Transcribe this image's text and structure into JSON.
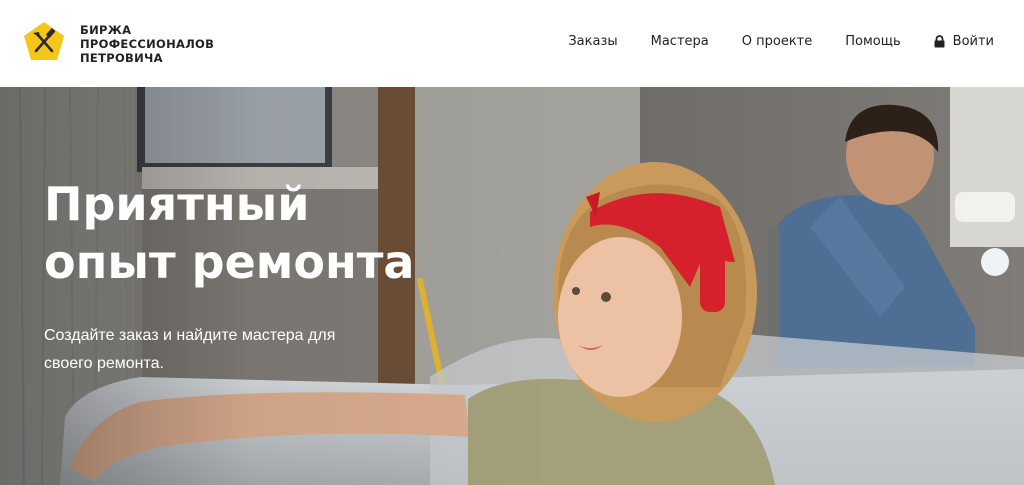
{
  "header": {
    "logo_icon": "hammer-shovel-pentagon-icon",
    "logo_lines": [
      "БИРЖА",
      "ПРОФЕССИОНАЛОВ",
      "ПЕТРОВИЧА"
    ],
    "nav": [
      {
        "label": "Заказы"
      },
      {
        "label": "Мастера"
      },
      {
        "label": "О проекте"
      },
      {
        "label": "Помощь"
      },
      {
        "label": "Войти",
        "icon": "lock-icon"
      }
    ]
  },
  "hero": {
    "title_line1": "Приятный",
    "title_line2": "опыт ремонта",
    "subtitle": "Создайте заказ и найдите мастера для своего ремонта."
  },
  "colors": {
    "accent": "#f5c518",
    "text": "#222222",
    "hero_text": "#ffffff",
    "bandana": "#e0202e"
  }
}
